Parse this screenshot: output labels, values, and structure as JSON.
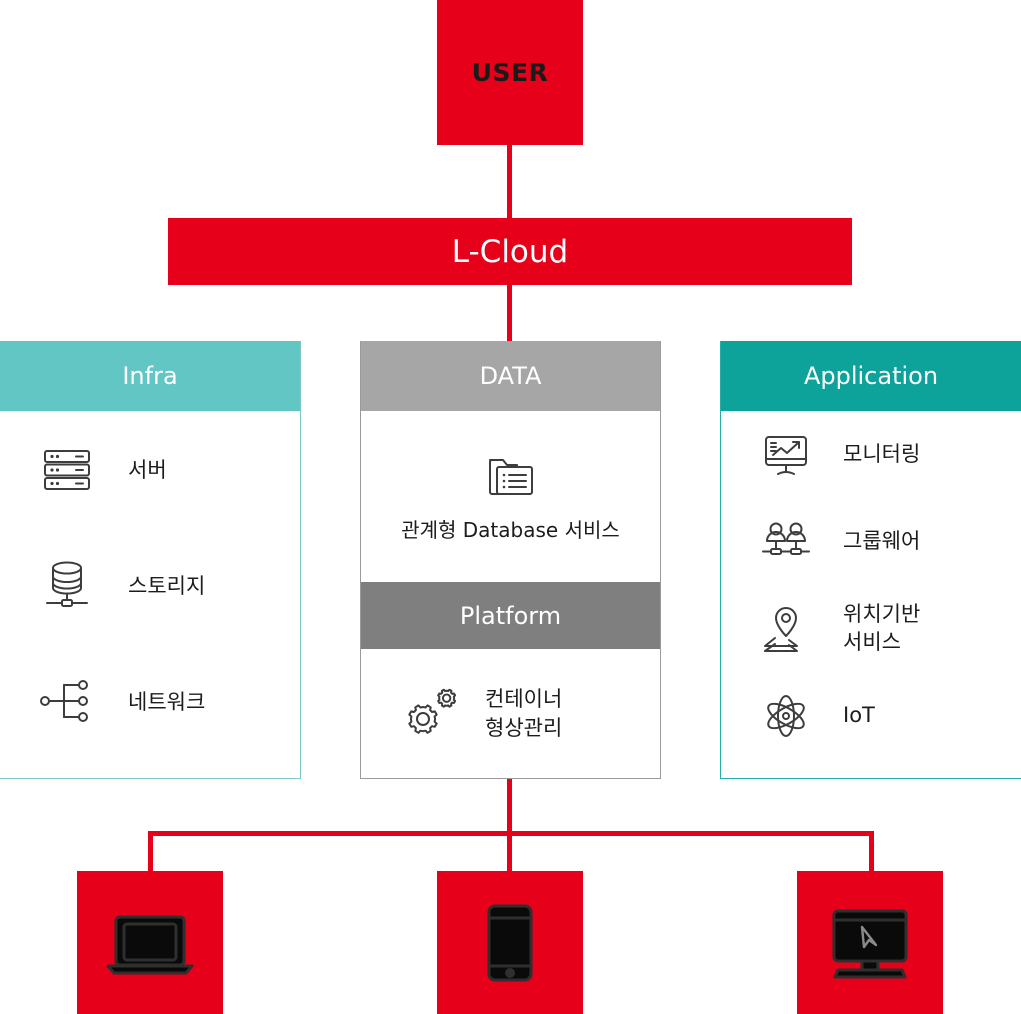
{
  "theme": {
    "red": "#E6001A",
    "infra_teal": "#62C6C4",
    "infra_border": "#7EC8C6",
    "data_gray": "#A6A6A6",
    "platform_gray": "#7F7F7F",
    "app_teal": "#0DA39B",
    "app_border": "#24AFA8",
    "icon_stroke": "#3d3d3d",
    "text_dark": "#1c1c1c",
    "text_white": "#ffffff"
  },
  "top": {
    "user_label": "USER",
    "cloud_label": "L-Cloud"
  },
  "columns": {
    "infra": {
      "header": "Infra",
      "items": [
        {
          "label": "서버",
          "icon": "server-rack-icon"
        },
        {
          "label": "스토리지",
          "icon": "storage-cylinder-icon"
        },
        {
          "label": "네트워크",
          "icon": "network-nodes-icon"
        }
      ]
    },
    "data": {
      "header": "DATA",
      "caption": "관계형 Database 서비스",
      "icon": "folder-list-icon"
    },
    "platform": {
      "header": "Platform",
      "label_line1": "컨테이너",
      "label_line2": "형상관리",
      "icon": "gears-icon"
    },
    "application": {
      "header": "Application",
      "items": [
        {
          "label_line1": "모니터링",
          "label_line2": "",
          "icon": "monitoring-chart-icon"
        },
        {
          "label_line1": "그룹웨어",
          "label_line2": "",
          "icon": "groupware-people-icon"
        },
        {
          "label_line1": "위치기반",
          "label_line2": "서비스",
          "icon": "location-pin-layers-icon"
        },
        {
          "label_line1": "IoT",
          "label_line2": "",
          "icon": "atom-icon"
        }
      ]
    }
  },
  "devices": [
    {
      "name": "laptop",
      "icon": "laptop-icon"
    },
    {
      "name": "mobile",
      "icon": "mobile-phone-icon"
    },
    {
      "name": "desktop",
      "icon": "desktop-monitor-cursor-icon"
    }
  ]
}
